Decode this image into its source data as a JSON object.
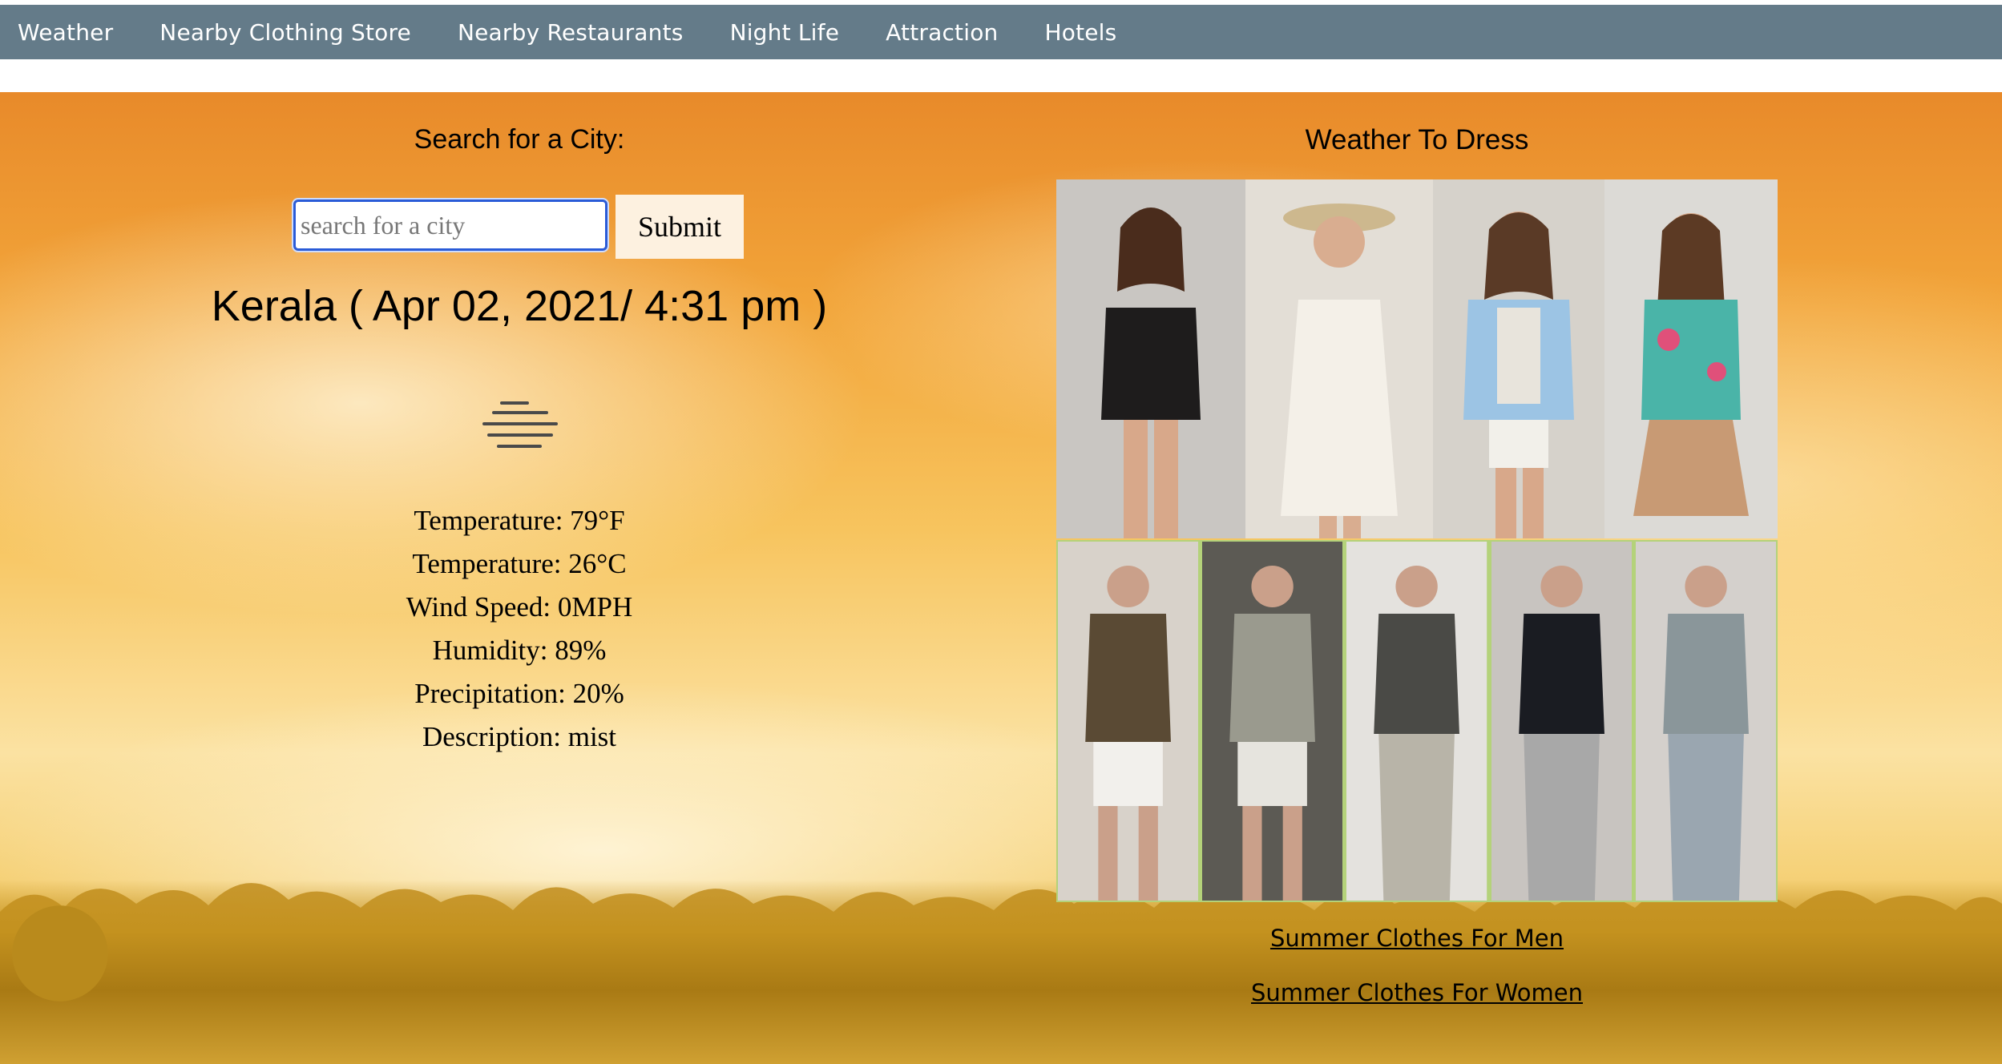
{
  "nav": {
    "items": [
      "Weather",
      "Nearby Clothing Store",
      "Nearby Restaurants",
      "Night Life",
      "Attraction",
      "Hotels"
    ]
  },
  "search": {
    "title": "Search for a City:",
    "placeholder": "search for a city",
    "submit_label": "Submit"
  },
  "current": {
    "heading": "Kerala ( Apr 02, 2021/ 4:31 pm )",
    "icon": "mist-icon",
    "temperature_f": "Temperature: 79°F",
    "temperature_c": "Temperature: 26°C",
    "wind": "Wind Speed: 0MPH",
    "humidity": "Humidity: 89%",
    "precipitation": "Precipitation: 20%",
    "description": "Description: mist"
  },
  "dress": {
    "title": "Weather To Dress",
    "link_men": "Summer Clothes For Men",
    "link_women": "Summer Clothes For Women"
  },
  "colors": {
    "nav_bg": "#647b89",
    "input_border": "#2a5bd7",
    "submit_bg": "#fdf1e0",
    "collage_border": "#b4d27a"
  }
}
